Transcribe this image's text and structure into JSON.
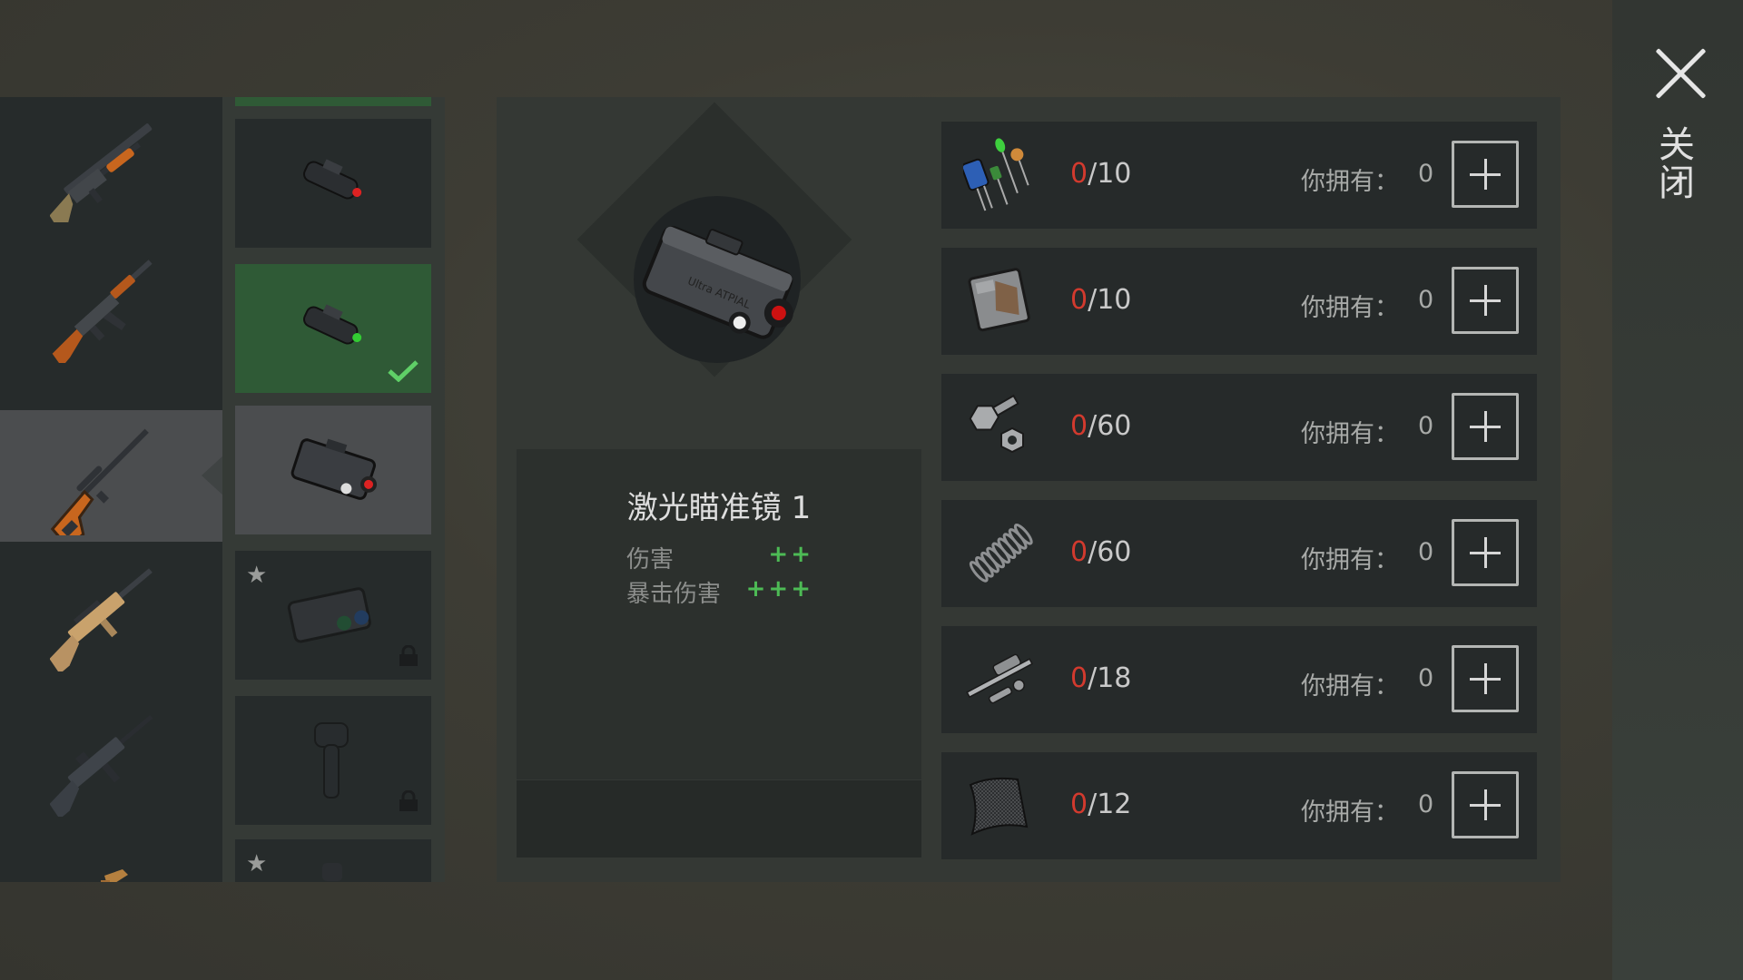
{
  "close": {
    "label": "关闭"
  },
  "weapons": [
    {
      "name": "shotgun",
      "selected": false
    },
    {
      "name": "ak-rifle",
      "selected": false
    },
    {
      "name": "sniper-rifle",
      "selected": true
    },
    {
      "name": "scar-rifle",
      "selected": false
    },
    {
      "name": "m16-rifle",
      "selected": false
    },
    {
      "name": "pistol-partial",
      "selected": false
    }
  ],
  "attachments": [
    {
      "icon": "scope-red-dot-icon",
      "state": "available"
    },
    {
      "icon": "scope-green-dot-icon",
      "state": "equipped"
    },
    {
      "icon": "laser-sight-icon",
      "state": "selected"
    },
    {
      "icon": "laser-sight-blue-icon",
      "state": "locked",
      "starred": true
    },
    {
      "icon": "vertical-grip-icon",
      "state": "locked"
    },
    {
      "icon": "attachment-partial-icon",
      "state": "available",
      "starred": true
    }
  ],
  "item": {
    "name": "激光瞄准镜 1",
    "stats": [
      {
        "label": "伤害",
        "value": "++"
      },
      {
        "label": "暴击伤害",
        "value": "+++"
      }
    ]
  },
  "materials": [
    {
      "icon": "electronic-components-icon",
      "current": "0",
      "required": "/10",
      "owned_label": "你拥有：",
      "owned": "0"
    },
    {
      "icon": "metal-plate-icon",
      "current": "0",
      "required": "/10",
      "owned_label": "你拥有：",
      "owned": "0"
    },
    {
      "icon": "bolt-nut-icon",
      "current": "0",
      "required": "/60",
      "owned_label": "你拥有：",
      "owned": "0"
    },
    {
      "icon": "spring-icon",
      "current": "0",
      "required": "/60",
      "owned_label": "你拥有：",
      "owned": "0"
    },
    {
      "icon": "gun-parts-icon",
      "current": "0",
      "required": "/18",
      "owned_label": "你拥有：",
      "owned": "0"
    },
    {
      "icon": "carbon-sheet-icon",
      "current": "0",
      "required": "/12",
      "owned_label": "你拥有：",
      "owned": "0"
    }
  ],
  "colors": {
    "accent_green": "#4dbb55",
    "deficit_red": "#d23a2e",
    "equipped_bg": "#2f5a36"
  }
}
